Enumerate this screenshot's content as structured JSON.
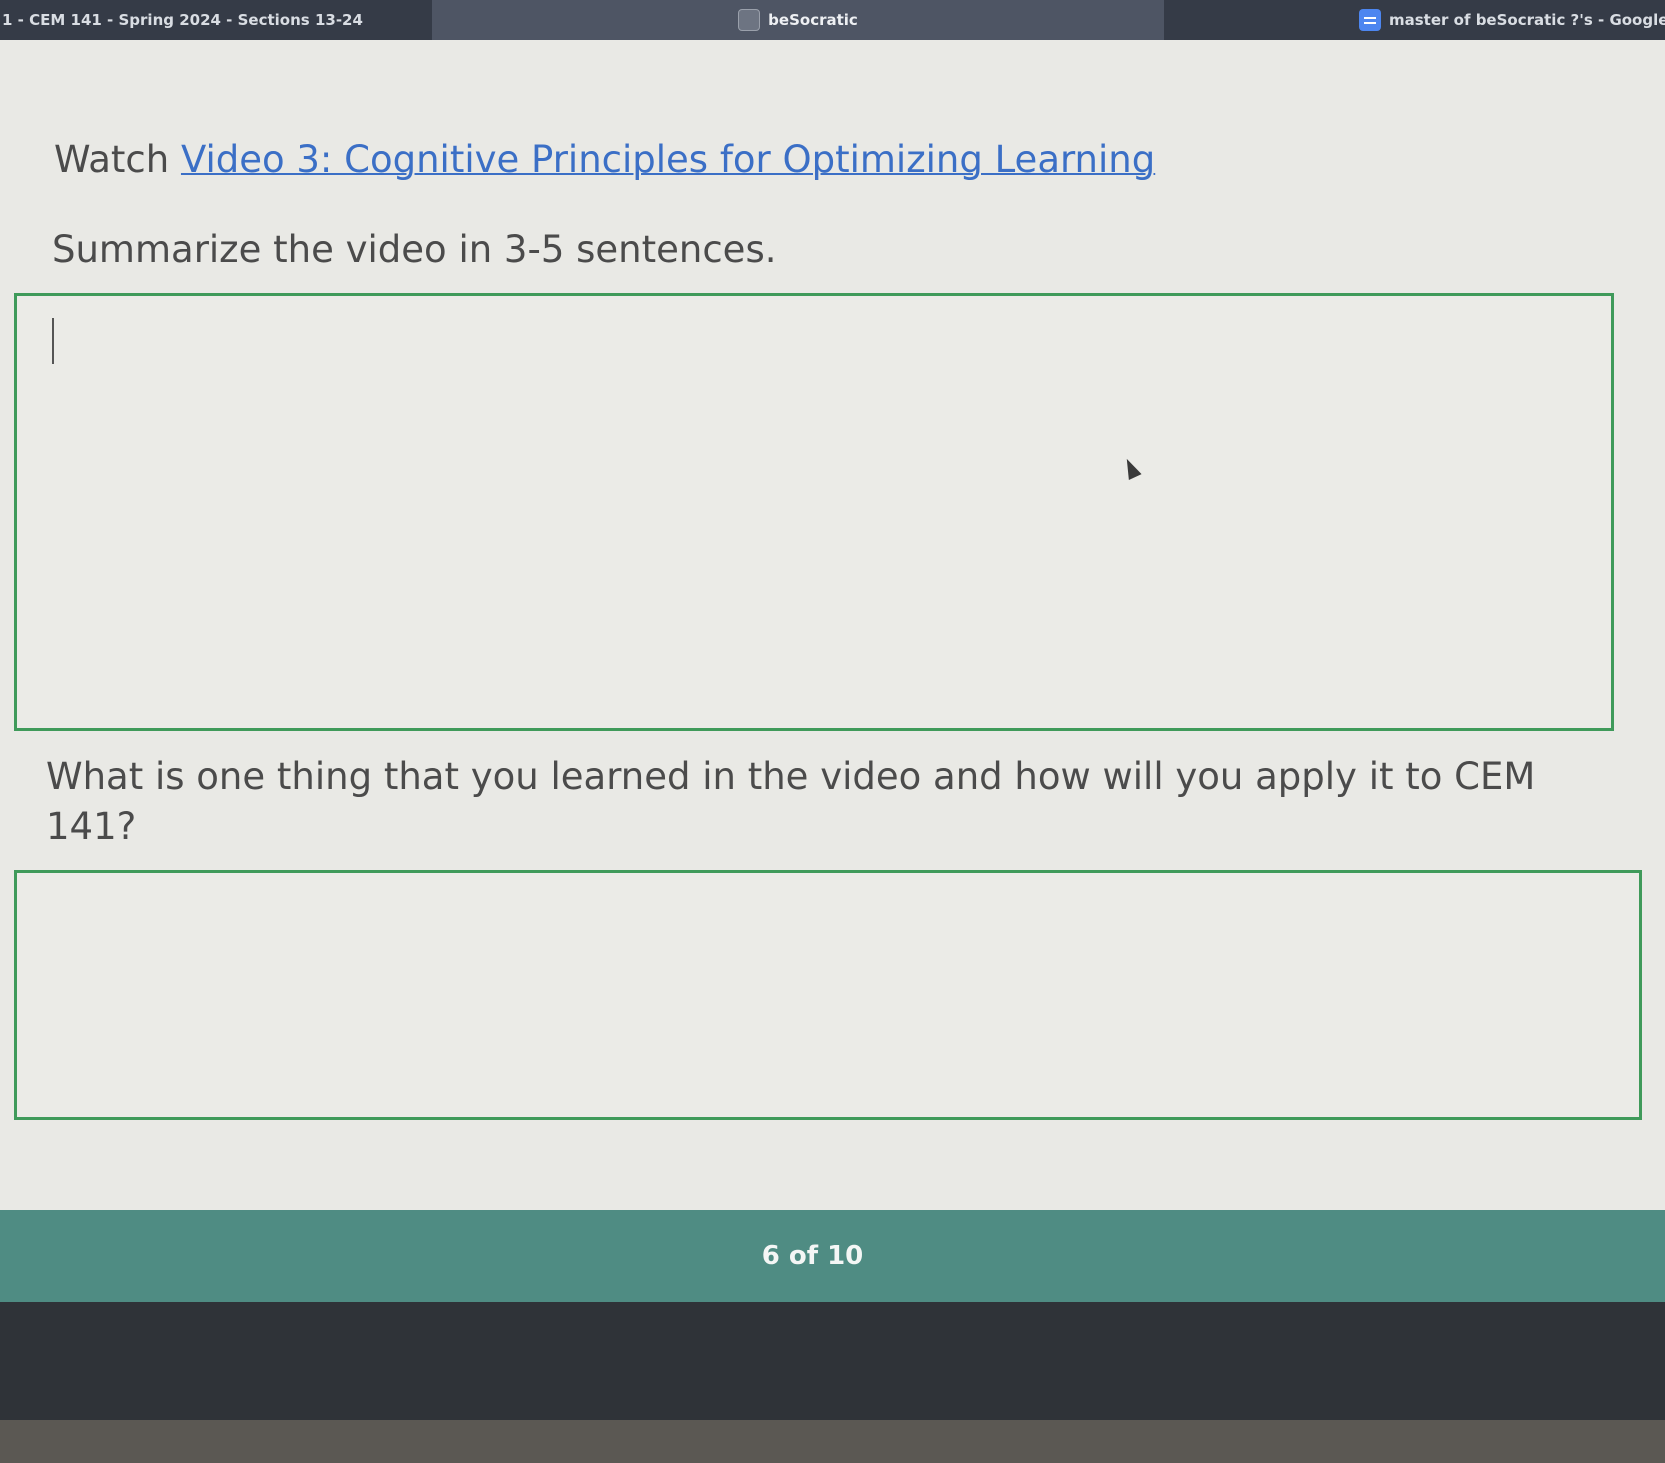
{
  "tabs": [
    {
      "label": "1 - CEM 141 - Spring 2024 - Sections 13-24"
    },
    {
      "label": "beSocratic",
      "icon": "besocratic-icon"
    },
    {
      "label": "master of beSocratic ?'s - Google D",
      "icon": "google-docs-icon"
    }
  ],
  "main": {
    "watch_prefix": "Watch ",
    "video_link": "Video 3: Cognitive Principles for Optimizing Learning",
    "question1": "Summarize the video in 3-5 sentences.",
    "answer1_value": "",
    "question2": "What is one thing that you learned in the video and how will you apply it to CEM 141?",
    "answer2_value": ""
  },
  "footer": {
    "page_counter": "6 of 10"
  },
  "colors": {
    "accent_border": "#3f9a5a",
    "link": "#3b6fc6",
    "footer_bg": "#4f8c83",
    "tabbar_bg": "#3b4250"
  }
}
